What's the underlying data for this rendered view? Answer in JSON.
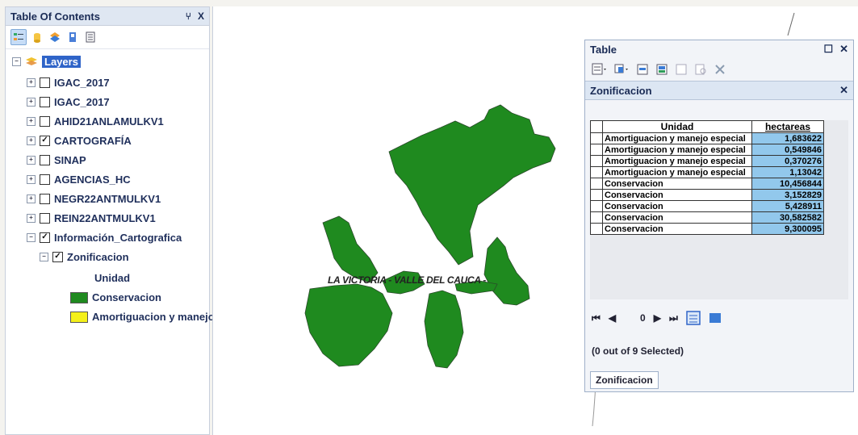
{
  "toc": {
    "title": "Table Of Contents",
    "pin_glyph": "⑂",
    "close_glyph": "X",
    "root": "Layers",
    "layers": [
      {
        "name": "IGAC_2017",
        "checked": false
      },
      {
        "name": "IGAC_2017",
        "checked": false
      },
      {
        "name": "AHID21ANLAMULKV1",
        "checked": false
      },
      {
        "name": "CARTOGRAFÍA",
        "checked": true
      },
      {
        "name": "SINAP",
        "checked": false
      },
      {
        "name": "AGENCIAS_HC",
        "checked": false
      },
      {
        "name": "NEGR22ANTMULKV1",
        "checked": false
      },
      {
        "name": "REIN22ANTMULKV1",
        "checked": false
      },
      {
        "name": "Información_Cartografica",
        "checked": true
      }
    ],
    "sublayer": "Zonificacion",
    "field": "Unidad",
    "legend": [
      {
        "label": "Conservacion",
        "color": "#1f8a1f"
      },
      {
        "label": "Amortiguacion y manejo e",
        "color": "#f4f01a"
      }
    ]
  },
  "map": {
    "label": "LA VICTORIA - VALLE DEL CAUCA -",
    "fill_color": "#1f8a1f"
  },
  "table_window": {
    "title": "Table",
    "tab_title": "Zonificacion",
    "columns": [
      "Unidad",
      "hectareas"
    ],
    "rows": [
      [
        "Amortiguacion y manejo especial",
        "1,683622"
      ],
      [
        "Amortiguacion y manejo especial",
        "0,549846"
      ],
      [
        "Amortiguacion y manejo especial",
        "0,370276"
      ],
      [
        "Amortiguacion y manejo especial",
        "1,13042"
      ],
      [
        "Conservacion",
        "10,456844"
      ],
      [
        "Conservacion",
        "3,152829"
      ],
      [
        "Conservacion",
        "5,428911"
      ],
      [
        "Conservacion",
        "30,582582"
      ],
      [
        "Conservacion",
        "9,300095"
      ]
    ],
    "record": "0",
    "status": "(0 out of 9 Selected)",
    "bottom_tab": "Zonificacion"
  }
}
